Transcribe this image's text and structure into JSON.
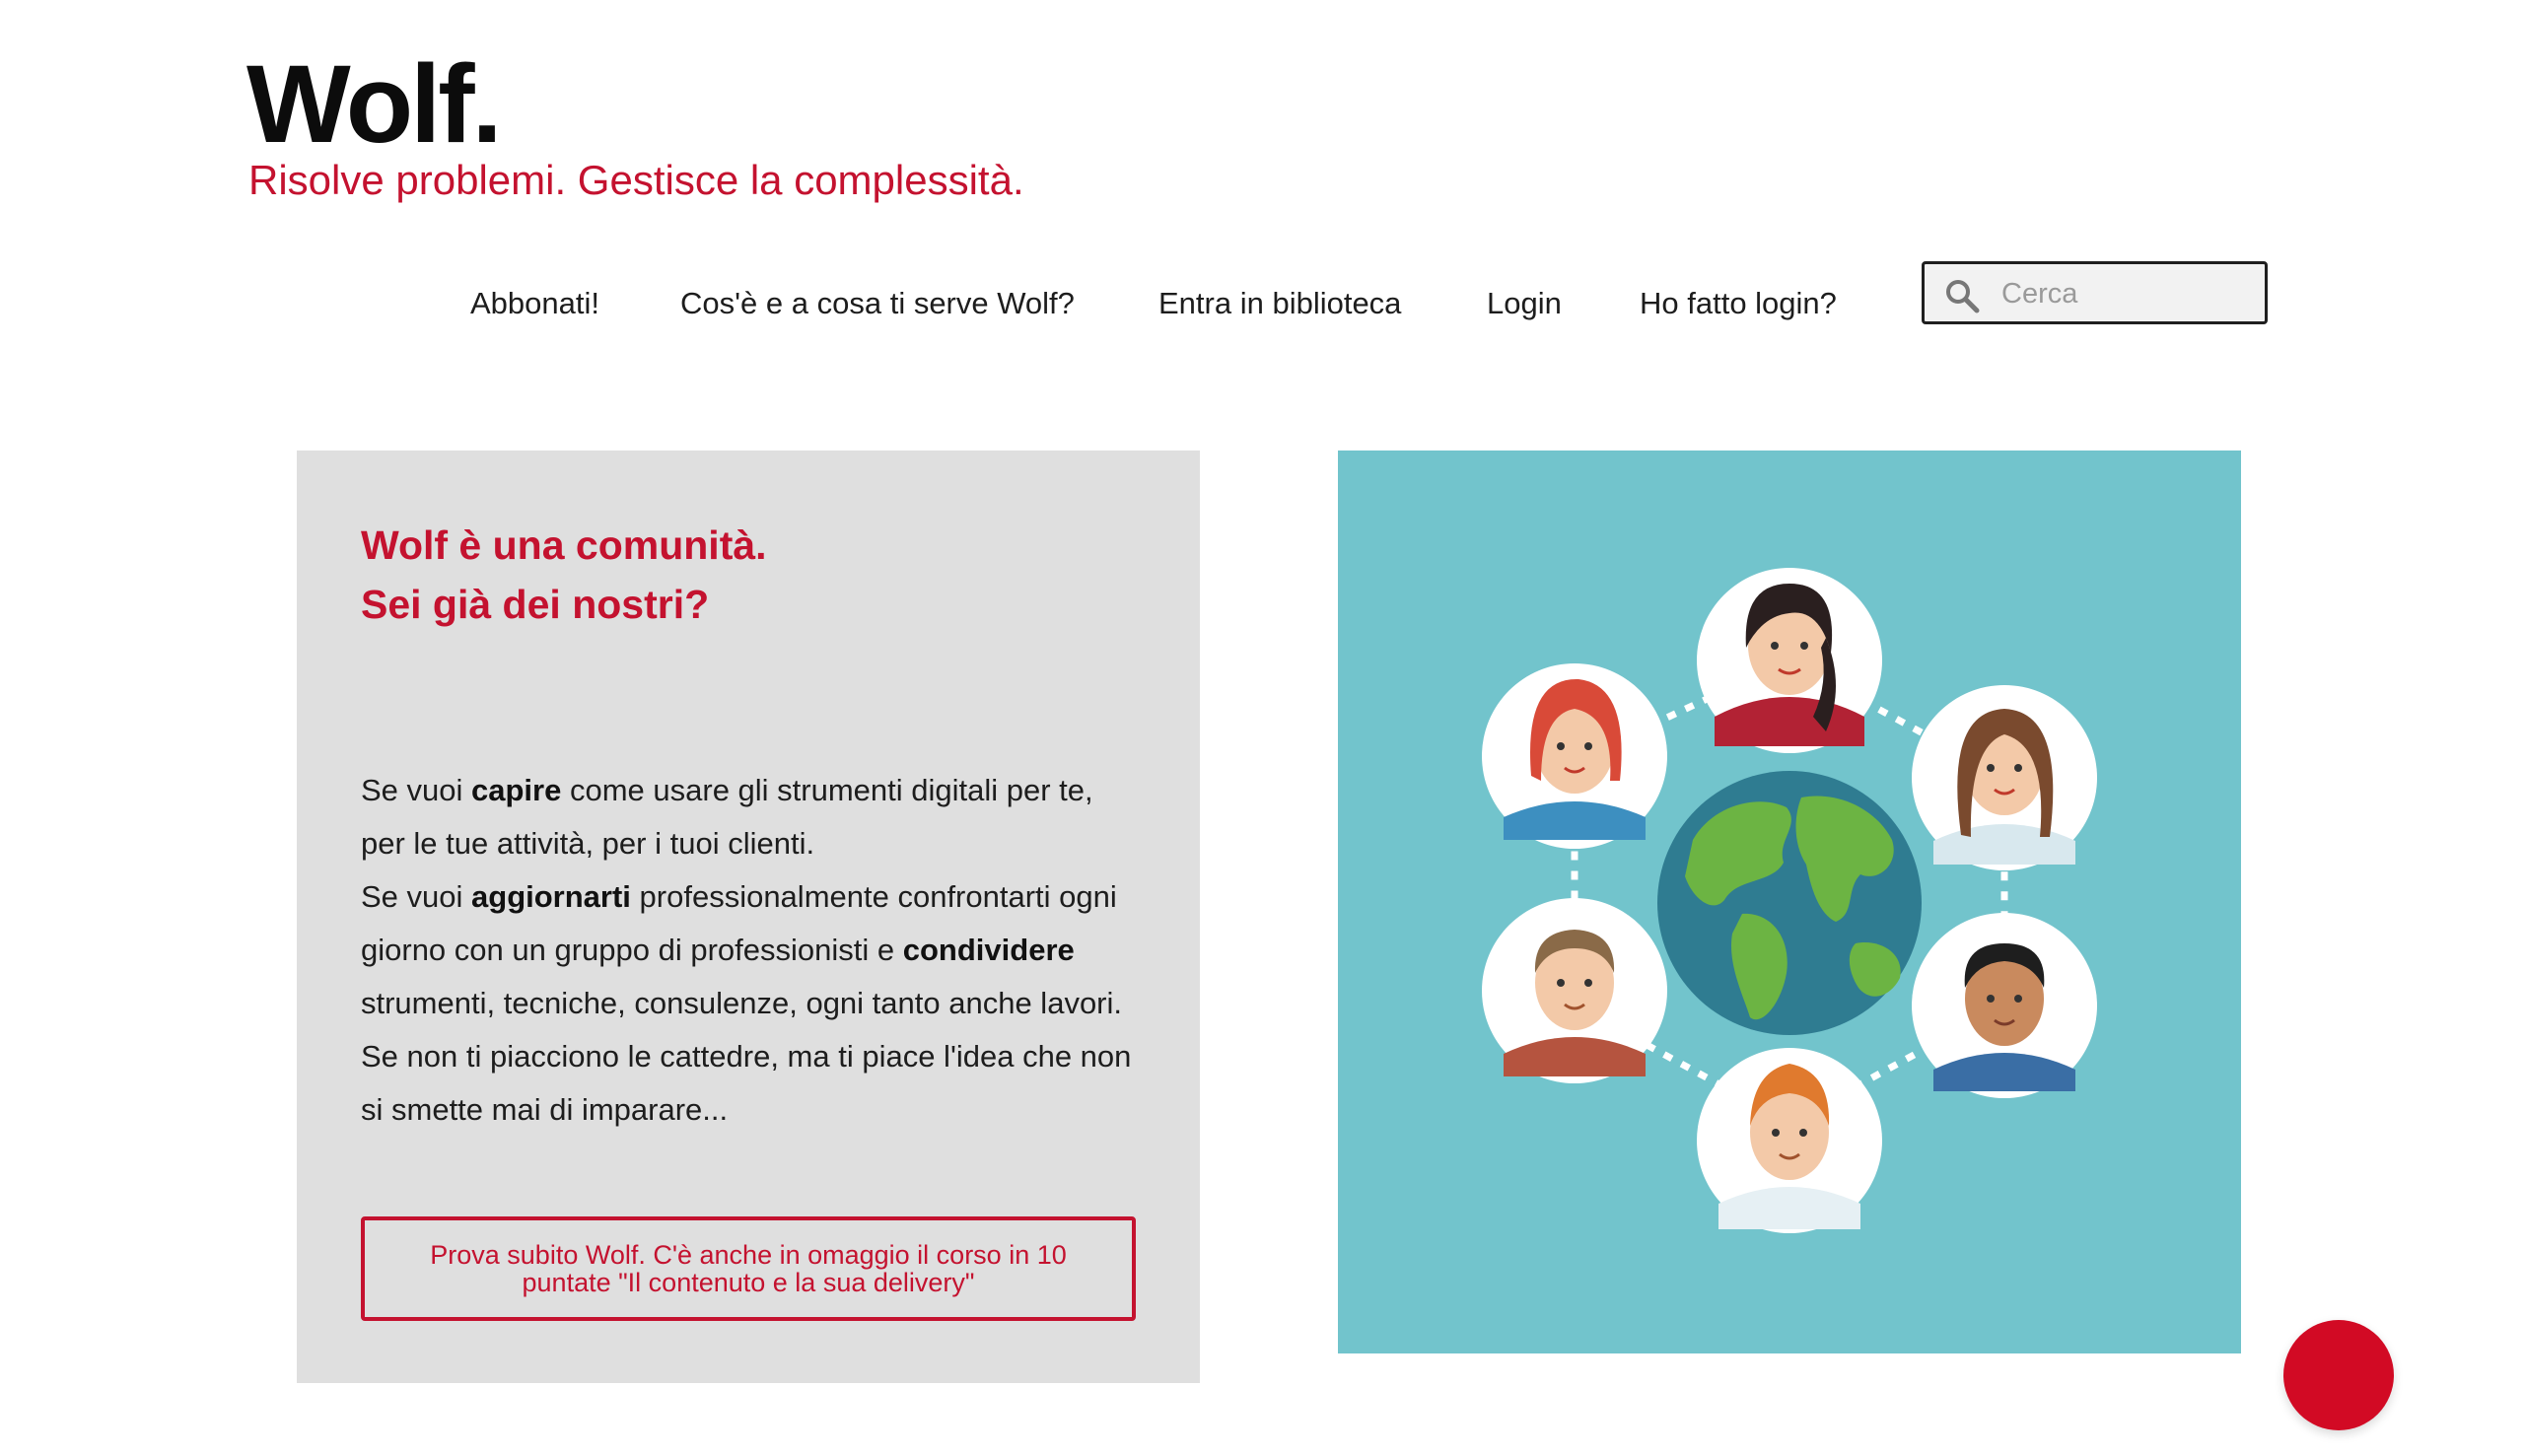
{
  "header": {
    "logo": "Wolf.",
    "tagline": "Risolve problemi. Gestisce la complessità."
  },
  "nav": {
    "items": [
      {
        "label": "Abbonati!"
      },
      {
        "label": "Cos'è e a cosa ti serve Wolf?"
      },
      {
        "label": "Entra in biblioteca"
      },
      {
        "label": "Login"
      },
      {
        "label": "Ho fatto login?"
      }
    ]
  },
  "search": {
    "placeholder": "Cerca",
    "icon": "search-icon"
  },
  "card": {
    "headline_line1": "Wolf è una comunità.",
    "headline_line2": "Sei già dei nostri?",
    "p1_pre": "Se vuoi ",
    "p1_bold": "capire",
    "p1_post": " come usare gli strumenti digitali per te, per le tue attività, per i tuoi clienti.",
    "p2_pre": "Se vuoi ",
    "p2_bold": "aggiornarti",
    "p2_mid": " professionalmente confrontarti ogni giorno con un gruppo di professionisti e ",
    "p2_bold2": "condividere",
    "p2_post": " strumenti, tecniche, consulenze, ogni tanto anche lavori.",
    "p3": "Se non ti piacciono le cattedre, ma ti piace l'idea che non si smette mai di imparare...",
    "cta_label": "Prova subito Wolf. C'è anche in omaggio il corso in 10 puntate \"Il contenuto e la sua delivery\""
  },
  "colors": {
    "brand_red": "#c4122f",
    "card_bg": "#dfdfdf",
    "illustration_bg": "#72c4cc",
    "fab": "#d20a24"
  }
}
